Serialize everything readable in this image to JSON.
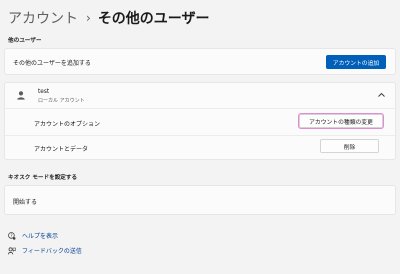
{
  "breadcrumb": {
    "parent": "アカウント",
    "separator": "›",
    "current": "その他のユーザー"
  },
  "other_users": {
    "section_title": "他のユーザー",
    "add_row_label": "その他のユーザーを追加する",
    "add_button": "アカウントの追加"
  },
  "user": {
    "name": "test",
    "type": "ローカル アカウント",
    "options_label": "アカウントのオプション",
    "change_type_button": "アカウントの種類の変更",
    "data_label": "アカウントとデータ",
    "delete_button": "削除"
  },
  "kiosk": {
    "section_title": "キオスク モードを設定する",
    "start_label": "開始する"
  },
  "links": {
    "help": "ヘルプを表示",
    "feedback": "フィードバックの送信"
  },
  "colors": {
    "accent": "#005fb8",
    "highlight": "#e38bd2"
  }
}
